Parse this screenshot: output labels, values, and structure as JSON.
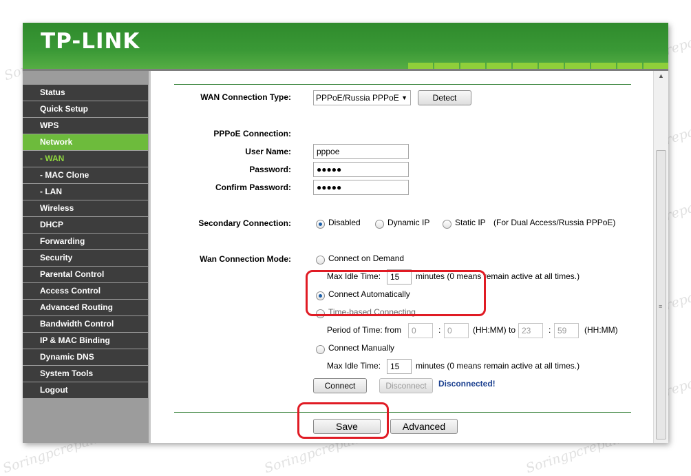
{
  "brand": {
    "logo": "TP-LINK"
  },
  "sidebar": {
    "items": [
      {
        "label": "Status"
      },
      {
        "label": "Quick Setup"
      },
      {
        "label": "WPS"
      },
      {
        "label": "Network"
      },
      {
        "label": "- WAN"
      },
      {
        "label": "- MAC Clone"
      },
      {
        "label": "- LAN"
      },
      {
        "label": "Wireless"
      },
      {
        "label": "DHCP"
      },
      {
        "label": "Forwarding"
      },
      {
        "label": "Security"
      },
      {
        "label": "Parental Control"
      },
      {
        "label": "Access Control"
      },
      {
        "label": "Advanced Routing"
      },
      {
        "label": "Bandwidth Control"
      },
      {
        "label": "IP & MAC Binding"
      },
      {
        "label": "Dynamic DNS"
      },
      {
        "label": "System Tools"
      },
      {
        "label": "Logout"
      }
    ]
  },
  "wan": {
    "connection_type_label": "WAN Connection Type:",
    "connection_type_value": "PPPoE/Russia PPPoE",
    "detect_label": "Detect",
    "pppoe_heading": "PPPoE Connection:",
    "username_label": "User Name:",
    "username_value": "pppoe",
    "password_label": "Password:",
    "password_value": "●●●●●",
    "confirm_label": "Confirm Password:",
    "confirm_value": "●●●●●",
    "secondary_label": "Secondary Connection:",
    "secondary_disabled": "Disabled",
    "secondary_dynamic": "Dynamic IP",
    "secondary_static": "Static IP",
    "secondary_note": "(For Dual Access/Russia PPPoE)",
    "mode_label": "Wan Connection Mode:",
    "mode_on_demand": "Connect on Demand",
    "max_idle_label_1": "Max Idle Time:",
    "max_idle_value_1": "15",
    "idle_note_1": "minutes (0 means remain active at all times.)",
    "mode_auto": "Connect Automatically",
    "mode_time_based": "Time-based Connecting",
    "period_label": "Period of Time: from",
    "from_hh": "0",
    "colon_1": ":",
    "from_mm": "0",
    "hhmm_to": "(HH:MM) to",
    "to_hh": "23",
    "colon_2": ":",
    "to_mm": "59",
    "hhmm_end": "(HH:MM)",
    "mode_manual": "Connect Manually",
    "max_idle_label_2": "Max Idle Time:",
    "max_idle_value_2": "15",
    "idle_note_2": "minutes (0 means remain active at all times.)",
    "connect_label": "Connect",
    "disconnect_label": "Disconnect",
    "status_text": "Disconnected!",
    "save_label": "Save",
    "advanced_label": "Advanced"
  },
  "watermark": "Soringpcrepair.Com",
  "colors": {
    "header_green": "#3a9936",
    "menu_active": "#6dbb3c",
    "menu_bg": "#3d3d3d",
    "highlight_red": "#e01b24",
    "status_blue": "#1a3f8f"
  }
}
